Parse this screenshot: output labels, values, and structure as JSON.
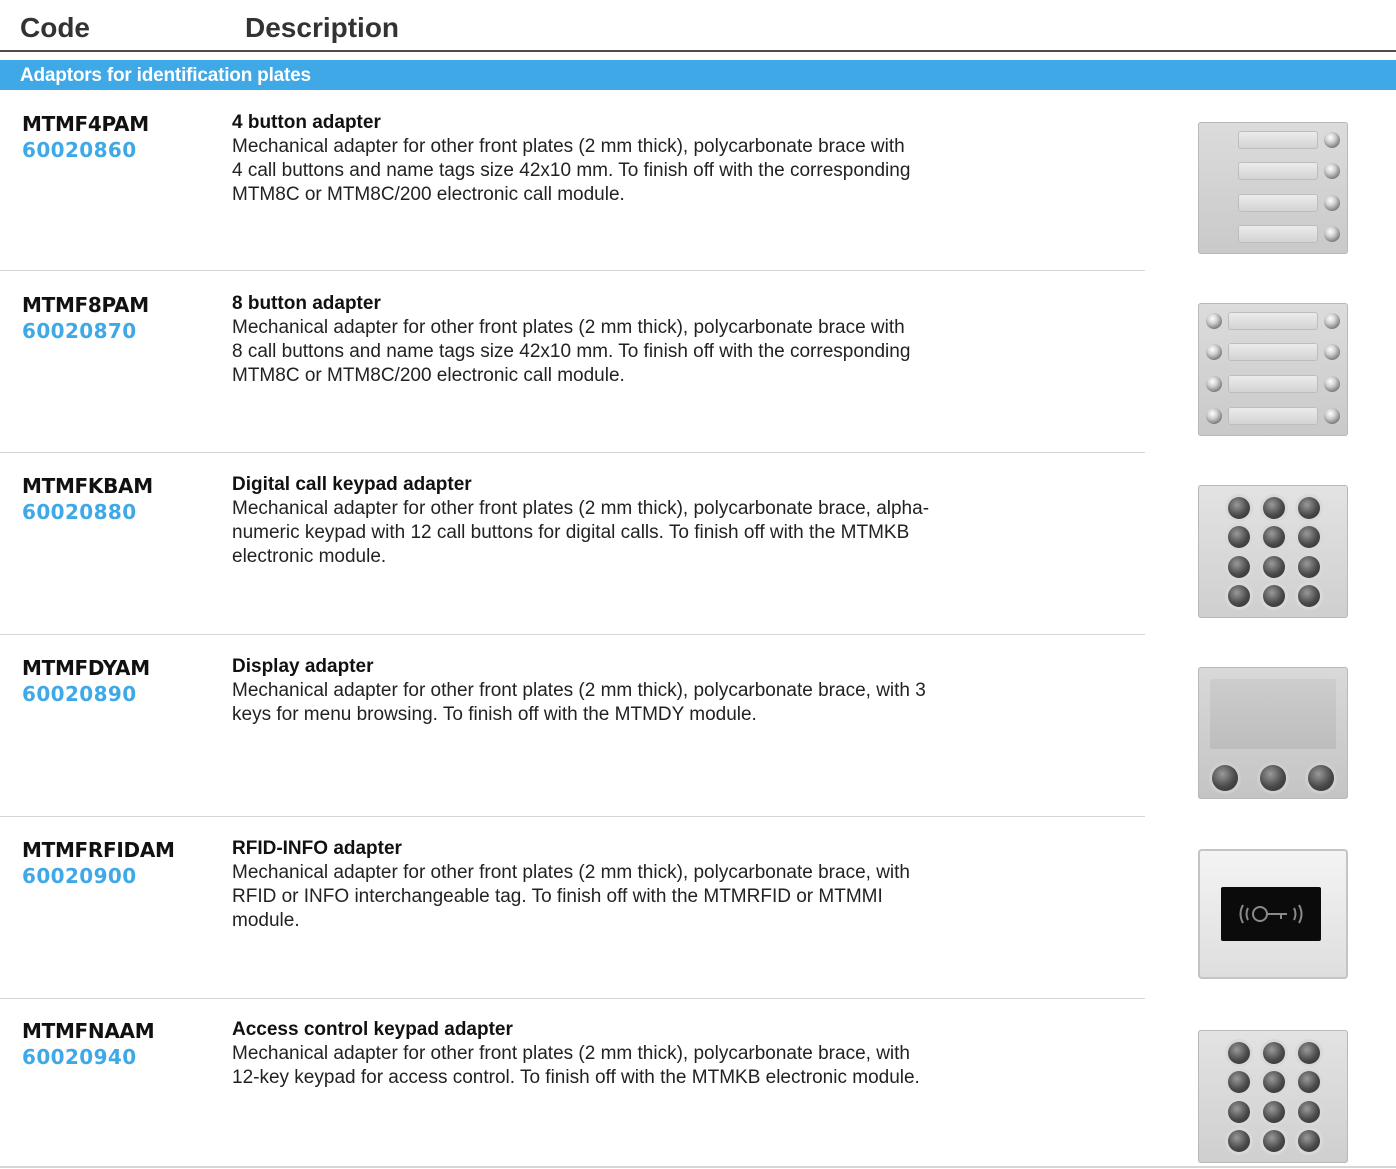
{
  "header": {
    "code_label": "Code",
    "description_label": "Description"
  },
  "section": {
    "title": "Adaptors for identification plates"
  },
  "items": [
    {
      "code": "MTMF4PAM",
      "number": "60020860",
      "title": "4 button adapter",
      "description": "Mechanical adapter for other front plates (2 mm thick), polycarbonate brace with\n4 call buttons and name tags size 42x10 mm. To finish off with the corresponding\nMTM8C or MTM8C/200 electronic call module.",
      "image_icon": "four-button-panel-icon"
    },
    {
      "code": "MTMF8PAM",
      "number": "60020870",
      "title": "8 button adapter",
      "description": "Mechanical adapter for other front plates (2 mm thick), polycarbonate brace with\n8 call buttons and name tags size 42x10 mm. To finish off with the corresponding\nMTM8C or MTM8C/200 electronic call module.",
      "image_icon": "eight-button-panel-icon"
    },
    {
      "code": "MTMFKBAM",
      "number": "60020880",
      "title": "Digital call keypad adapter",
      "description": "Mechanical adapter for other front plates (2 mm thick), polycarbonate brace, alpha-\nnumeric keypad with 12 call buttons for digital calls. To finish off with the MTMKB\nelectronic module.",
      "image_icon": "keypad-panel-icon"
    },
    {
      "code": "MTMFDYAM",
      "number": "60020890",
      "title": "Display adapter",
      "description": "Mechanical adapter for other front plates (2 mm thick), polycarbonate brace, with 3\nkeys for menu browsing. To finish off with the MTMDY module.",
      "image_icon": "display-panel-icon"
    },
    {
      "code": "MTMFRFIDAM",
      "number": "60020900",
      "title": "RFID-INFO adapter",
      "description": "Mechanical adapter for other front plates (2 mm thick), polycarbonate brace, with\nRFID or INFO interchangeable tag. To finish off with the MTMRFID or MTMMI\nmodule.",
      "image_icon": "rfid-panel-icon"
    },
    {
      "code": "MTMFNAAM",
      "number": "60020940",
      "title": "Access control keypad adapter",
      "description": "Mechanical adapter for other front plates (2 mm thick), polycarbonate brace, with\n12-key keypad for access control. To finish off with the MTMKB electronic module.",
      "image_icon": "access-keypad-panel-icon"
    }
  ]
}
